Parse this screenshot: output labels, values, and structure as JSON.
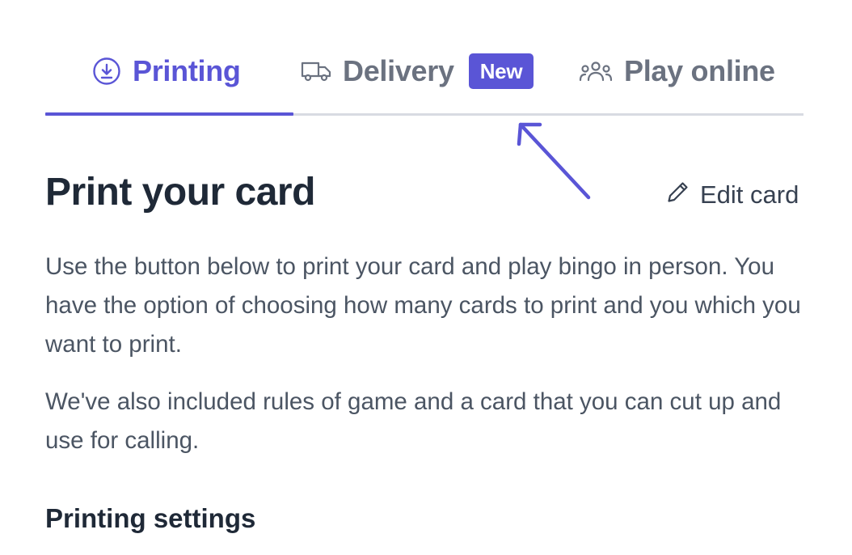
{
  "tabs": [
    {
      "label": "Printing",
      "icon": "download-circle-icon",
      "active": true
    },
    {
      "label": "Delivery",
      "icon": "truck-icon",
      "active": false,
      "badge": "New"
    },
    {
      "label": "Play online",
      "icon": "users-icon",
      "active": false
    }
  ],
  "colors": {
    "accent": "#5a55d6",
    "muted": "#6b7280",
    "text": "#1f2937",
    "rule": "#d8dbe2"
  },
  "main": {
    "title": "Print your card",
    "edit_label": "Edit card",
    "paragraphs": [
      "Use the button below to print your card and play bingo in person. You have the option of choosing how many cards to print and you which you want to print.",
      "We've also included rules of game and a card that you can cut up and use for calling."
    ],
    "section_title": "Printing settings"
  }
}
